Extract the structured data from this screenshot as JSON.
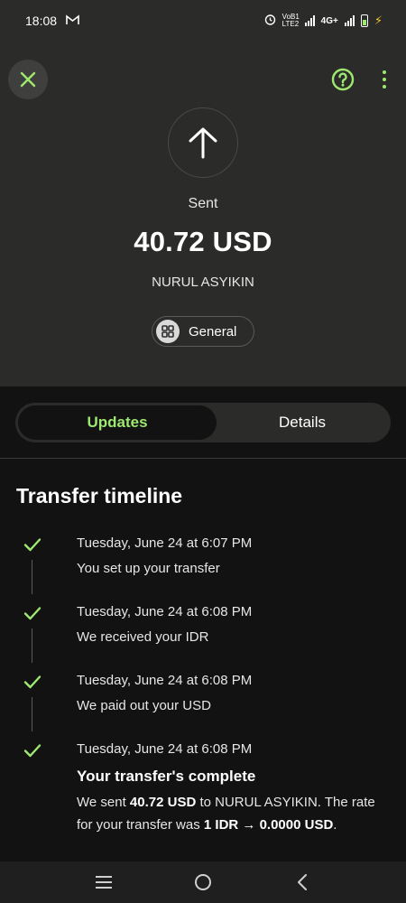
{
  "status_bar": {
    "time": "18:08",
    "mail_icon": "gmail-icon",
    "volte_label": "VoB1 LTE2",
    "network_label": "4G+"
  },
  "header": {
    "close_icon": "close-icon",
    "help_icon": "help-icon",
    "more_icon": "more-vertical-icon",
    "direction_icon": "arrow-up-icon",
    "status_label": "Sent",
    "amount": "40.72 USD",
    "recipient": "NURUL ASYIKIN",
    "category_icon": "grid-icon",
    "category_label": "General"
  },
  "tabs": [
    {
      "label": "Updates",
      "active": true
    },
    {
      "label": "Details",
      "active": false
    }
  ],
  "timeline": {
    "title": "Transfer timeline",
    "items": [
      {
        "date": "Tuesday, June 24 at 6:07 PM",
        "text": "You set up your transfer"
      },
      {
        "date": "Tuesday, June 24 at 6:08 PM",
        "text": "We received your IDR"
      },
      {
        "date": "Tuesday, June 24 at 6:08 PM",
        "text": "We paid out your USD"
      },
      {
        "date": "Tuesday, June 24 at 6:08 PM",
        "text": "Your transfer's complete"
      }
    ],
    "final_detail": {
      "p1": "We sent ",
      "amount": "40.72 USD",
      "p2": " to NURUL ASYIKIN. The rate for your transfer was ",
      "rate": "1 IDR → 0.0000 USD",
      "p3": "."
    }
  },
  "navbar": {
    "recents_icon": "recents-icon",
    "home_icon": "home-icon",
    "back_icon": "back-icon"
  },
  "colors": {
    "accent": "#9fe870",
    "header_bg": "#2b2c2a",
    "body_bg": "#121212"
  }
}
